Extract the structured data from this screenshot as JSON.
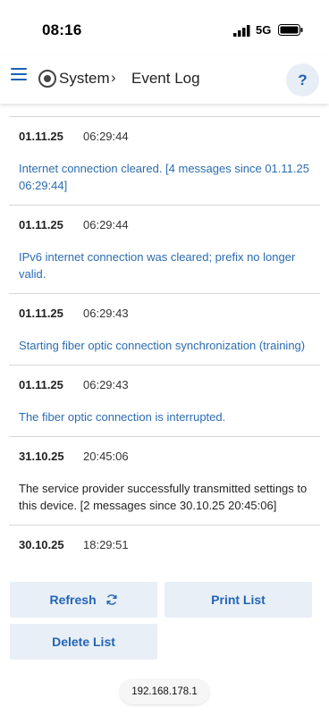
{
  "status_bar": {
    "time": "08:16",
    "network": "5G"
  },
  "header": {
    "menu_icon": "hamburger-icon",
    "system_icon": "system-icon",
    "breadcrumb_system": "System",
    "breadcrumb_separator": "›",
    "page_title": "Event Log",
    "help_label": "?"
  },
  "accent_color": "#1a5fb4",
  "log": [
    {
      "date": "01.11.25",
      "time": "06:29:44",
      "message": "Internet connection cleared. [4 messages since 01.11.25 06:29:44]",
      "style": "blue"
    },
    {
      "date": "01.11.25",
      "time": "06:29:44",
      "message": "IPv6 internet connection was cleared; prefix no longer valid.",
      "style": "blue"
    },
    {
      "date": "01.11.25",
      "time": "06:29:43",
      "message": "Starting fiber optic connection synchronization (training)",
      "style": "blue"
    },
    {
      "date": "01.11.25",
      "time": "06:29:43",
      "message": "The fiber optic connection is interrupted.",
      "style": "blue"
    },
    {
      "date": "31.10.25",
      "time": "20:45:06",
      "message": "The service provider successfully transmitted settings to this device. [2 messages since 30.10.25 20:45:06]",
      "style": "dark"
    },
    {
      "date": "30.10.25",
      "time": "18:29:51",
      "message": "",
      "style": "dark"
    }
  ],
  "actions": {
    "refresh": "Refresh",
    "print": "Print List",
    "delete": "Delete List"
  },
  "url": "192.168.178.1"
}
